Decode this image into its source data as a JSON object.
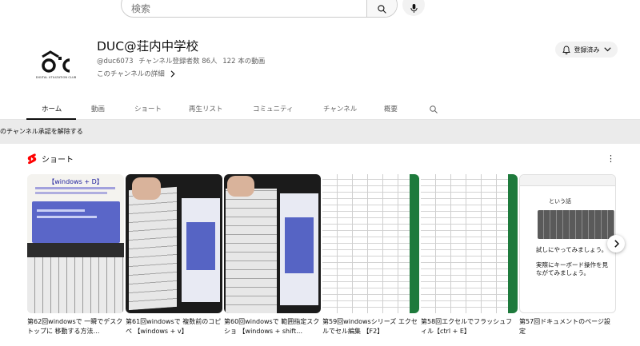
{
  "search": {
    "placeholder": "検索"
  },
  "channel": {
    "avatar_tag": "DIGITAL UTILIZATION CLUB",
    "name": "DUC@荘内中学校",
    "handle": "@duc6073",
    "subscribers": "チャンネル登録者数 86人",
    "videos": "122 本の動画",
    "details": "このチャンネルの詳細",
    "subscribe_label": "登録済み"
  },
  "tabs": [
    {
      "label": "ホーム"
    },
    {
      "label": "動画"
    },
    {
      "label": "ショート"
    },
    {
      "label": "再生リスト"
    },
    {
      "label": "コミュニティ"
    },
    {
      "label": "チャンネル"
    },
    {
      "label": "概要"
    }
  ],
  "notice": {
    "text": "のチャンネル承認を解除する"
  },
  "shorts": {
    "heading": "ショート",
    "items": [
      {
        "title": "第62回windowsで 一瞬でデスクトップに 移動する方法…",
        "thumb_caption": "【windows + D】"
      },
      {
        "title": "第61回windowsで 複数前のコピペ 【windows + v】"
      },
      {
        "title": "第60回windowsで 範囲指定スクショ 【windows + shift…"
      },
      {
        "title": "第59回windowsシリーズ エクセルでセル編集 【F2】"
      },
      {
        "title": "第58回エクセルでフラッシュフィル【ctrl + E】"
      },
      {
        "title": "第57回ドキュメントのページ設定",
        "thumb_caption": "という話",
        "thumb_text_1": "試しにやってみましょう。",
        "thumb_text_2": "実際にキーボード操作を見ながてみましょう。"
      }
    ]
  },
  "colors": {
    "shorts_red": "#ff0000",
    "text_secondary": "#606060"
  }
}
